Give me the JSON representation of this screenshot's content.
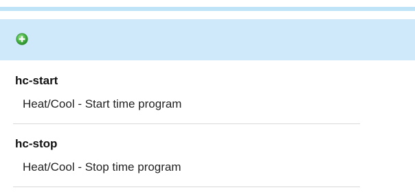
{
  "toolbar": {
    "add_icon": "plus-circle-icon",
    "accent_color": "#cfe9fb",
    "icon_color": "#4caf50"
  },
  "items": [
    {
      "name": "hc-start",
      "description": "Heat/Cool - Start time program"
    },
    {
      "name": "hc-stop",
      "description": "Heat/Cool - Stop time program"
    }
  ]
}
